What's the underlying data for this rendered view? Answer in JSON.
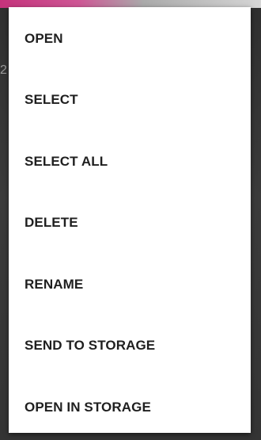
{
  "menu": {
    "items": [
      {
        "label": "OPEN"
      },
      {
        "label": "SELECT"
      },
      {
        "label": "SELECT ALL"
      },
      {
        "label": "DELETE"
      },
      {
        "label": "RENAME"
      },
      {
        "label": "SEND TO STORAGE"
      },
      {
        "label": "OPEN IN STORAGE"
      }
    ]
  },
  "background": {
    "edge_glyph": "2"
  }
}
